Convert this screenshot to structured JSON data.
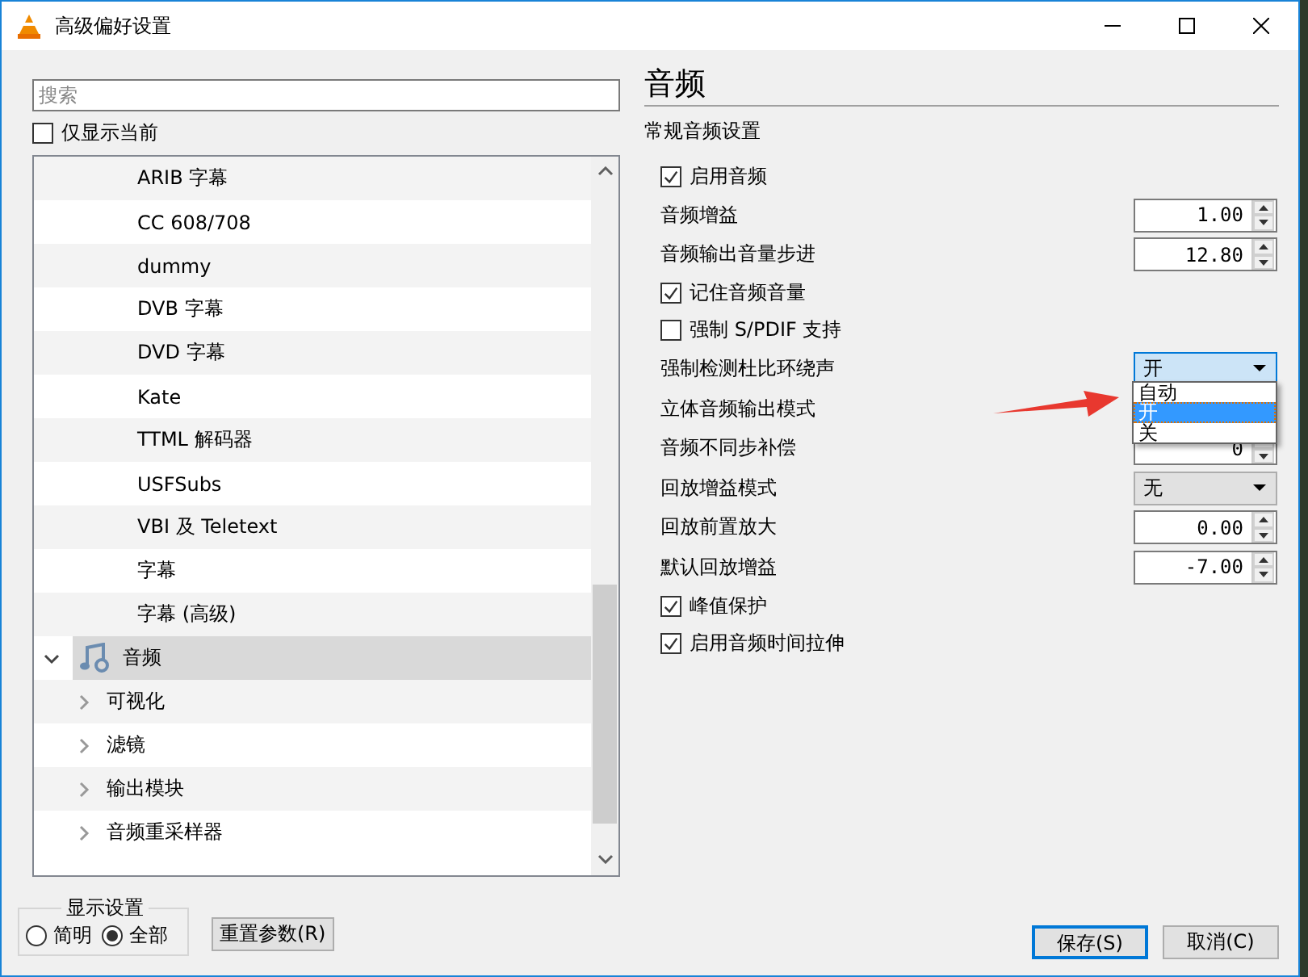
{
  "window": {
    "title": "高级偏好设置"
  },
  "search": {
    "placeholder": "搜索"
  },
  "show_current_only": {
    "label": "仅显示当前",
    "checked": false
  },
  "tree": {
    "partial_group": [
      {
        "label": "ARIB 字幕",
        "selected": false
      },
      {
        "label": "CC 608/708",
        "selected": false
      },
      {
        "label": "dummy",
        "selected": false
      },
      {
        "label": "DVB 字幕",
        "selected": false
      },
      {
        "label": "DVD 字幕",
        "selected": false
      },
      {
        "label": "Kate",
        "selected": false
      },
      {
        "label": "TTML 解码器",
        "selected": false
      },
      {
        "label": "USFSubs",
        "selected": false
      },
      {
        "label": "VBI 及 Teletext",
        "selected": false
      },
      {
        "label": "字幕",
        "selected": false
      },
      {
        "label": "字幕 (高级)",
        "selected": false
      }
    ],
    "items": [
      {
        "label": "音频",
        "selected": true,
        "expanded": true,
        "children": [
          {
            "label": "可视化",
            "selected": false,
            "expanded": false
          },
          {
            "label": "滤镜",
            "selected": false,
            "expanded": false
          },
          {
            "label": "输出模块",
            "selected": false,
            "expanded": false
          },
          {
            "label": "音频重采样器",
            "selected": false,
            "expanded": false
          }
        ]
      }
    ]
  },
  "display_settings": {
    "title": "显示设置",
    "options": [
      {
        "label": "简明",
        "selected": false
      },
      {
        "label": "全部",
        "selected": true
      }
    ]
  },
  "reset_button": "重置参数(R)",
  "panel": {
    "title": "音频",
    "section": "常规音频设置",
    "settings": [
      {
        "kind": "checkbox",
        "label": "启用音频",
        "checked": true
      },
      {
        "kind": "spin",
        "label": "音频增益",
        "value": "1.00"
      },
      {
        "kind": "spin",
        "label": "音频输出音量步进",
        "value": "12.80"
      },
      {
        "kind": "checkbox",
        "label": "记住音频音量",
        "checked": true
      },
      {
        "kind": "checkbox",
        "label": "强制 S/PDIF 支持",
        "checked": false
      },
      {
        "kind": "combo",
        "label": "强制检测杜比环绕声",
        "value": "开",
        "open": true,
        "options": [
          {
            "label": "自动",
            "selected": false
          },
          {
            "label": "开",
            "selected": true
          },
          {
            "label": "关",
            "selected": false
          }
        ]
      },
      {
        "kind": "label",
        "label": "立体音频输出模式"
      },
      {
        "kind": "spin",
        "label": "音频不同步补偿",
        "value": "0"
      },
      {
        "kind": "combo",
        "label": "回放增益模式",
        "value": "无",
        "open": false
      },
      {
        "kind": "spin",
        "label": "回放前置放大",
        "value": "0.00"
      },
      {
        "kind": "spin",
        "label": "默认回放增益",
        "value": "-7.00"
      },
      {
        "kind": "checkbox",
        "label": "峰值保护",
        "checked": true
      },
      {
        "kind": "checkbox",
        "label": "启用音频时间拉伸",
        "checked": true
      }
    ]
  },
  "buttons": [
    {
      "label": "保存(S)",
      "default": true
    },
    {
      "label": "取消(C)",
      "default": false
    }
  ]
}
